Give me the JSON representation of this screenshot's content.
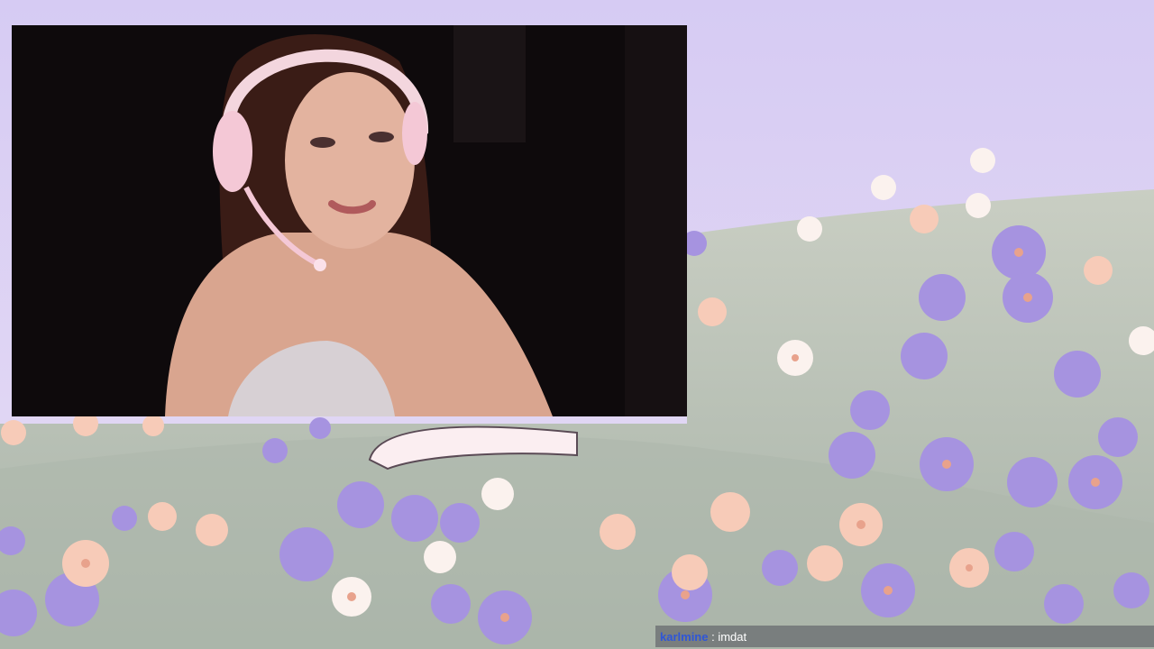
{
  "stream": {
    "background_scene": "lavender flower meadow illustration",
    "webcam_feed": "streamer webcam wearing pink headset",
    "chat_message": {
      "username": "karlmine",
      "separator": " : ",
      "text": "imdat"
    }
  },
  "colors": {
    "sky": "#d8cdf2",
    "meadow": "#b9c2b6",
    "flower_purple": "#a693e0",
    "flower_peach": "#f5c4b2",
    "chat_username": "#2f56d8"
  }
}
